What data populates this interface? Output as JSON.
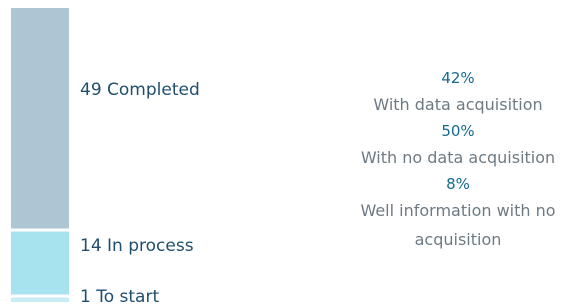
{
  "chart_data": [
    {
      "type": "bar",
      "subtype": "stacked-single-column",
      "categories": [
        "Completed",
        "In process",
        "To start"
      ],
      "values": [
        49,
        14,
        1
      ],
      "labels": [
        "49 Completed",
        "14 In process",
        "1 To start"
      ],
      "colors": [
        "#adc6d4",
        "#a7e3ef",
        "#c8eef4"
      ]
    },
    {
      "type": "table",
      "items": [
        {
          "percent": "42%",
          "value": 42,
          "label": "With data acquisition"
        },
        {
          "percent": "50%",
          "value": 50,
          "label": "With no data acquisition"
        },
        {
          "percent": "8%",
          "value": 8,
          "label": "Well information with no acquisition"
        }
      ],
      "colors": {
        "percent": "#136a8f",
        "label": "#6e7a83"
      }
    }
  ]
}
